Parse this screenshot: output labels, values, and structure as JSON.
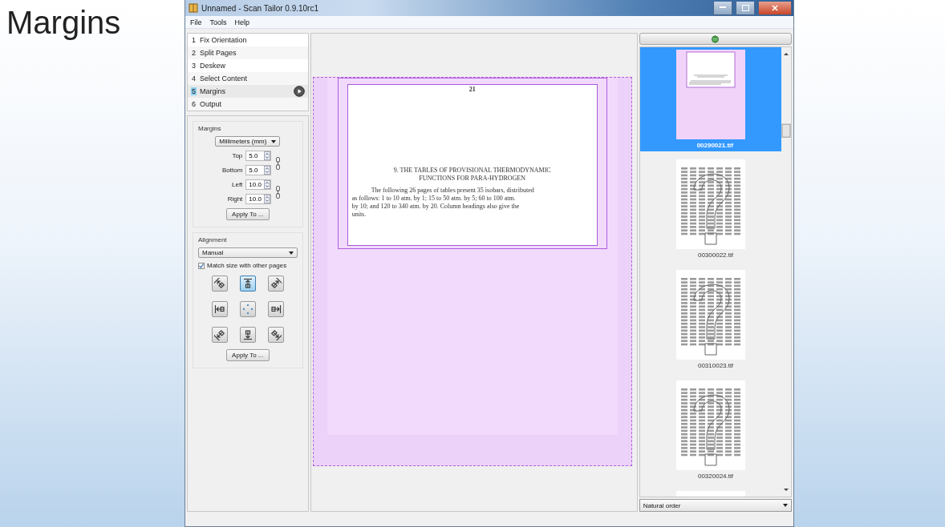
{
  "slide_title": "Margins",
  "window": {
    "title": "Unnamed - Scan Tailor 0.9.10rc1"
  },
  "menu": [
    "File",
    "Tools",
    "Help"
  ],
  "stages": [
    {
      "number": "1",
      "label": "Fix Orientation",
      "selected": false
    },
    {
      "number": "2",
      "label": "Split Pages",
      "selected": false
    },
    {
      "number": "3",
      "label": "Deskew",
      "selected": false
    },
    {
      "number": "4",
      "label": "Select Content",
      "selected": false
    },
    {
      "number": "5",
      "label": "Margins",
      "selected": true
    },
    {
      "number": "6",
      "label": "Output",
      "selected": false
    }
  ],
  "margins": {
    "title": "Margins",
    "units": "Millimeters (mm)",
    "apply": "Apply To ...",
    "fields": [
      {
        "label": "Top",
        "value": "5.0"
      },
      {
        "label": "Bottom",
        "value": "5.0"
      },
      {
        "label": "Left",
        "value": "10.0"
      },
      {
        "label": "Right",
        "value": "10.0"
      }
    ]
  },
  "alignment": {
    "title": "Alignment",
    "mode": "Manual",
    "match_size": {
      "label": "Match size with other pages",
      "checked": true
    },
    "apply": "Apply To ...",
    "buttons": [
      {
        "selected": false
      },
      {
        "selected": true
      },
      {
        "selected": false
      },
      {
        "selected": false
      },
      {
        "selected": false
      },
      {
        "selected": false
      },
      {
        "selected": false
      },
      {
        "selected": false
      },
      {
        "selected": false
      }
    ]
  },
  "page": {
    "number": "21",
    "heading": [
      "9.  THE TABLES OF PROVISIONAL THERMODYNAMIC",
      "FUNCTIONS FOR PARA-HYDROGEN"
    ],
    "lines": [
      "The following 26 pages of tables present 35 isobars, distributed",
      "as follows:  1 to 10 atm. by 1;  15 to 50 atm. by 5;  60 to 100 atm.",
      "by 10;  and 120 to 340 atm. by 20.   Column headings also give the",
      "units."
    ]
  },
  "thumbnails": [
    {
      "kind": "page",
      "filename": "00290021.tif",
      "selected": true
    },
    {
      "kind": "unknown",
      "filename": "00300022.tif",
      "selected": false
    },
    {
      "kind": "unknown",
      "filename": "00310023.tif",
      "selected": false
    },
    {
      "kind": "unknown",
      "filename": "00320024.tif",
      "selected": false
    },
    {
      "kind": "unknown",
      "selected": false
    }
  ],
  "sort_order": "Natural order"
}
